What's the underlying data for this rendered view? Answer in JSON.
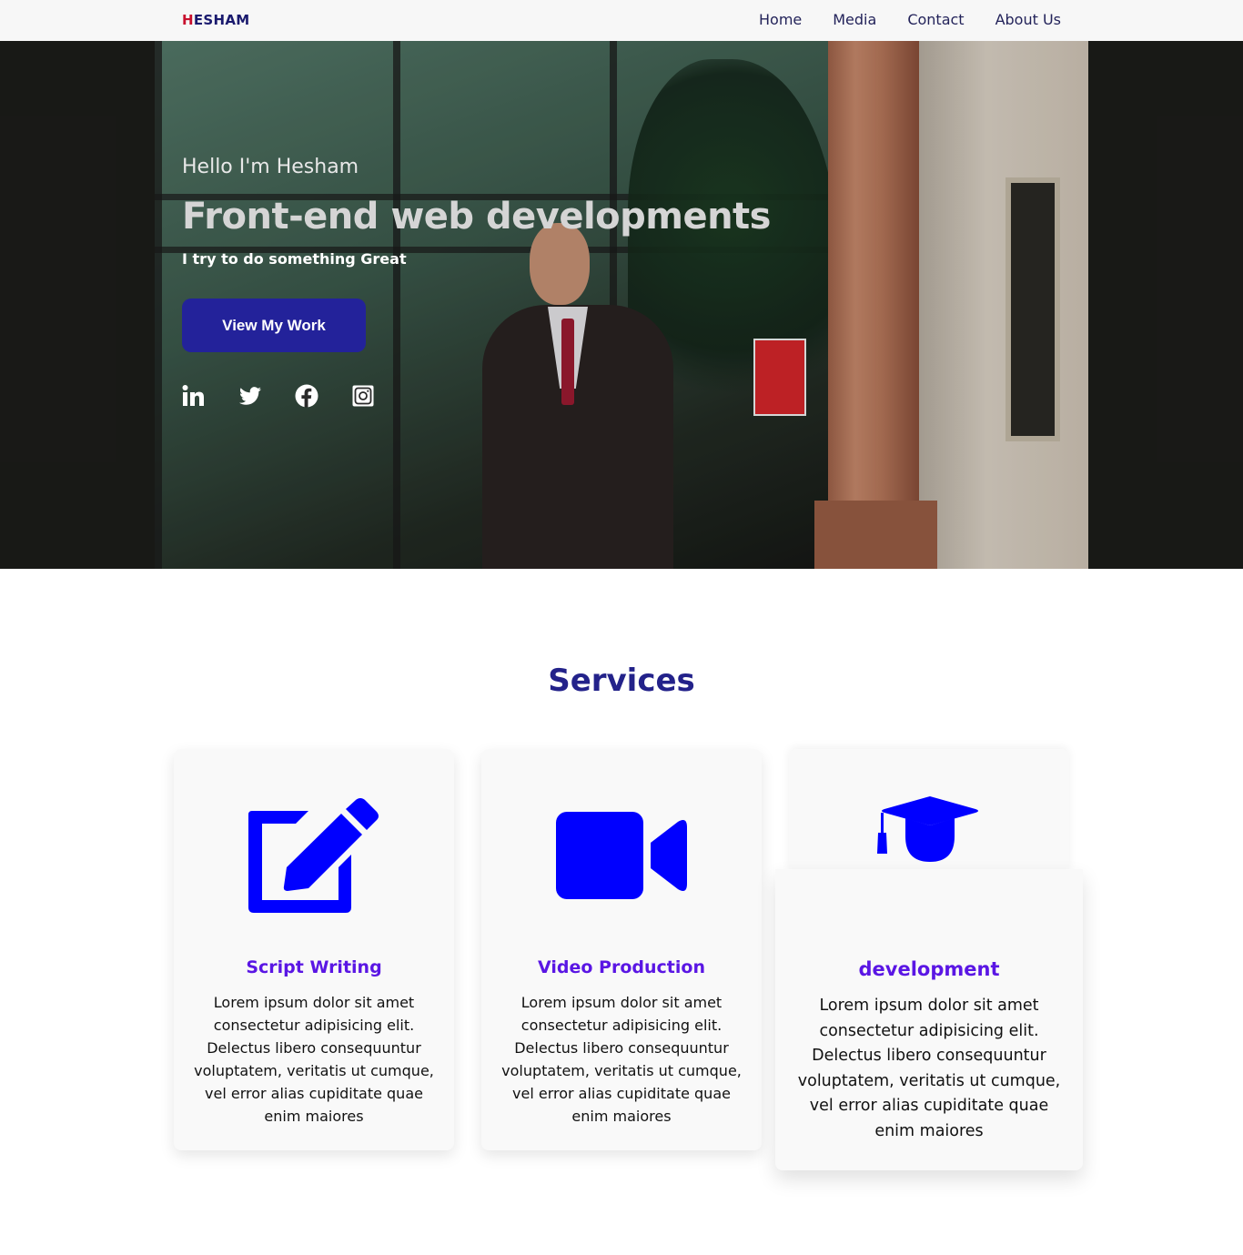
{
  "brand": {
    "first_letter": "H",
    "rest": "ESHAM"
  },
  "nav": {
    "items": [
      "Home",
      "Media",
      "Contact",
      "About Us"
    ]
  },
  "hero": {
    "greeting": "Hello I'm Hesham",
    "title": "Front-end web developments",
    "tagline": "I try to do something Great",
    "button_label": "View My Work",
    "socials": [
      "linkedin-icon",
      "twitter-icon",
      "facebook-icon",
      "instagram-icon"
    ]
  },
  "services": {
    "title": "Services",
    "cards": [
      {
        "icon": "edit-icon",
        "title": "Script Writing",
        "text": "Lorem ipsum dolor sit amet consectetur adipisicing elit. Delectus libero consequuntur voluptatem, veritatis ut cumque, vel error alias cupiditate quae enim maiores"
      },
      {
        "icon": "video-camera-icon",
        "title": "Video Production",
        "text": "Lorem ipsum dolor sit amet consectetur adipisicing elit. Delectus libero consequuntur voluptatem, veritatis ut cumque, vel error alias cupiditate quae enim maiores"
      },
      {
        "icon": "graduate-icon",
        "title": "development",
        "text": "Lorem ipsum dolor sit amet consectetur adipisicing elit. Delectus libero consequuntur voluptatem, veritatis ut cumque, vel error alias cupiditate quae enim maiores"
      }
    ]
  },
  "colors": {
    "accent": "#23229a",
    "icon_blue": "#0000ff",
    "card_title": "#5a16e4",
    "brand_red": "#c8102e"
  }
}
